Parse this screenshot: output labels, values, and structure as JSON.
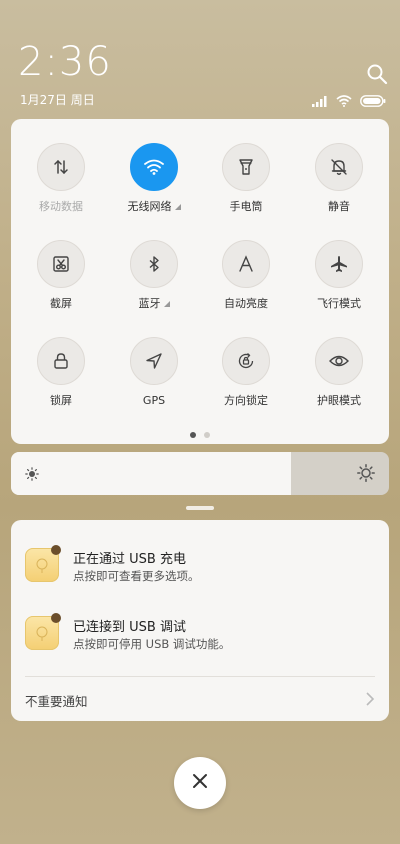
{
  "status": {
    "time": "2:36",
    "date": "1月27日 周日"
  },
  "quick_settings": {
    "tiles": [
      {
        "label": "移动数据",
        "icon": "mobile-data-icon",
        "active": false,
        "dim": true
      },
      {
        "label": "无线网络",
        "icon": "wifi-icon",
        "active": true,
        "dim": false
      },
      {
        "label": "手电筒",
        "icon": "flashlight-icon",
        "active": false,
        "dim": false
      },
      {
        "label": "静音",
        "icon": "mute-bell-icon",
        "active": false,
        "dim": false
      },
      {
        "label": "截屏",
        "icon": "screenshot-icon",
        "active": false,
        "dim": false
      },
      {
        "label": "蓝牙",
        "icon": "bluetooth-icon",
        "active": false,
        "dim": false
      },
      {
        "label": "自动亮度",
        "icon": "auto-brightness-icon",
        "active": false,
        "dim": false
      },
      {
        "label": "飞行模式",
        "icon": "airplane-icon",
        "active": false,
        "dim": false
      },
      {
        "label": "锁屏",
        "icon": "lock-icon",
        "active": false,
        "dim": false
      },
      {
        "label": "GPS",
        "icon": "gps-icon",
        "active": false,
        "dim": false
      },
      {
        "label": "方向锁定",
        "icon": "rotation-lock-icon",
        "active": false,
        "dim": false
      },
      {
        "label": "护眼模式",
        "icon": "eye-icon",
        "active": false,
        "dim": false
      }
    ],
    "page_count": 2,
    "current_page": 1
  },
  "brightness": {
    "level": 0.74
  },
  "notifications": {
    "items": [
      {
        "title": "正在通过 USB 充电",
        "subtitle": "点按即可查看更多选项。"
      },
      {
        "title": "已连接到 USB 调试",
        "subtitle": "点按即可停用 USB 调试功能。"
      }
    ],
    "unimportant_label": "不重要通知"
  },
  "colors": {
    "accent": "#1a97f0"
  }
}
